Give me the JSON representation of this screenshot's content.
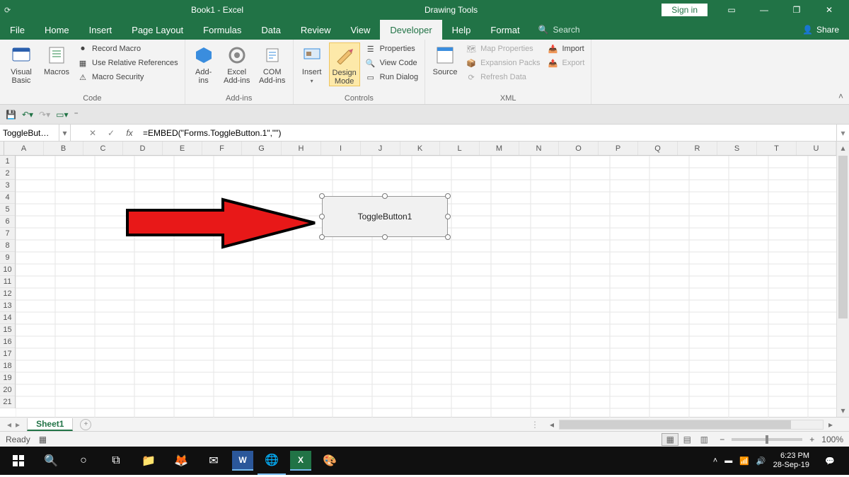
{
  "titlebar": {
    "title": "Book1 - Excel",
    "context_tab": "Drawing Tools",
    "signin": "Sign in"
  },
  "menu": {
    "file": "File",
    "home": "Home",
    "insert": "Insert",
    "pagelayout": "Page Layout",
    "formulas": "Formulas",
    "data": "Data",
    "review": "Review",
    "view": "View",
    "developer": "Developer",
    "help": "Help",
    "format": "Format",
    "search": "Search",
    "share": "Share"
  },
  "ribbon": {
    "code": {
      "visual_basic": "Visual\nBasic",
      "macros": "Macros",
      "record_macro": "Record Macro",
      "use_relative": "Use Relative References",
      "macro_security": "Macro Security",
      "group": "Code"
    },
    "addins": {
      "addins": "Add-\nins",
      "excel_addins": "Excel\nAdd-ins",
      "com_addins": "COM\nAdd-ins",
      "group": "Add-ins"
    },
    "controls": {
      "insert": "Insert",
      "design_mode": "Design\nMode",
      "properties": "Properties",
      "view_code": "View Code",
      "run_dialog": "Run Dialog",
      "group": "Controls"
    },
    "xml": {
      "source": "Source",
      "map_properties": "Map Properties",
      "expansion_packs": "Expansion Packs",
      "refresh_data": "Refresh Data",
      "import": "Import",
      "export": "Export",
      "group": "XML"
    }
  },
  "formula": {
    "namebox": "ToggleBut…",
    "value": "=EMBED(\"Forms.ToggleButton.1\",\"\")"
  },
  "columns": [
    "A",
    "B",
    "C",
    "D",
    "E",
    "F",
    "G",
    "H",
    "I",
    "J",
    "K",
    "L",
    "M",
    "N",
    "O",
    "P",
    "Q",
    "R",
    "S",
    "T",
    "U"
  ],
  "rows": [
    "1",
    "2",
    "3",
    "4",
    "5",
    "6",
    "7",
    "8",
    "9",
    "10",
    "11",
    "12",
    "13",
    "14",
    "15",
    "16",
    "17",
    "18",
    "19",
    "20",
    "21"
  ],
  "object": {
    "label": "ToggleButton1"
  },
  "sheet": {
    "name": "Sheet1"
  },
  "status": {
    "ready": "Ready",
    "zoom": "100%"
  },
  "tray": {
    "time": "6:23 PM",
    "date": "28-Sep-19"
  }
}
